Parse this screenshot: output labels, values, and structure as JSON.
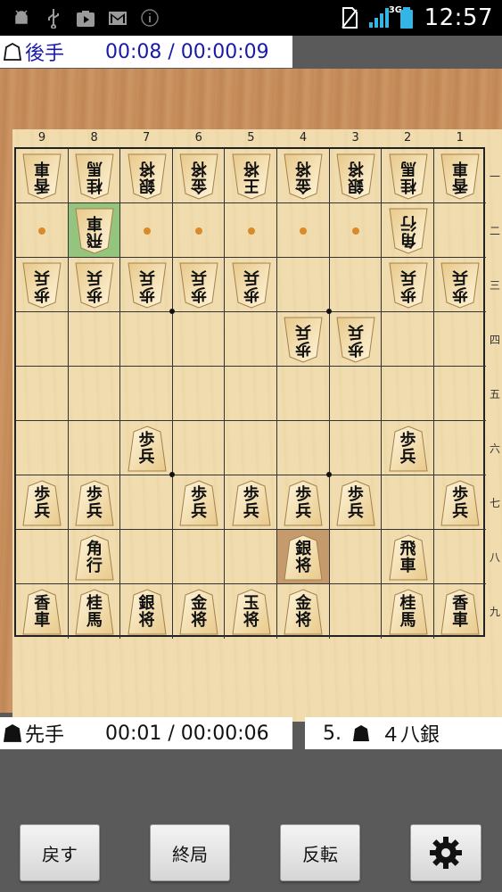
{
  "status_bar": {
    "time": "12:57",
    "network": "3G",
    "left_icons": [
      "android-debug-icon",
      "usb-icon",
      "play-store-icon",
      "gmail-icon",
      "info-icon"
    ],
    "right_icons": [
      "no-sim-icon",
      "signal-icon",
      "battery-icon"
    ]
  },
  "top_player": {
    "name": "後手",
    "time": "00:08 / 00:00:09"
  },
  "bottom_player": {
    "name": "先手",
    "time": "00:01 / 00:00:06"
  },
  "last_move": {
    "number": "5.",
    "text": "４八銀"
  },
  "board": {
    "file_labels": [
      "9",
      "8",
      "7",
      "6",
      "5",
      "4",
      "3",
      "2",
      "1"
    ],
    "rank_labels": [
      "一",
      "二",
      "三",
      "四",
      "五",
      "六",
      "七",
      "八",
      "九"
    ],
    "highlight_from": "8-2",
    "highlight_to": "4-8",
    "hint_cells": [
      "9-2",
      "7-2",
      "6-2",
      "5-2",
      "4-2",
      "3-2"
    ],
    "pieces": [
      {
        "file": 9,
        "rank": 1,
        "side": "gote",
        "label": "香車"
      },
      {
        "file": 8,
        "rank": 1,
        "side": "gote",
        "label": "桂馬"
      },
      {
        "file": 7,
        "rank": 1,
        "side": "gote",
        "label": "銀将"
      },
      {
        "file": 6,
        "rank": 1,
        "side": "gote",
        "label": "金将"
      },
      {
        "file": 5,
        "rank": 1,
        "side": "gote",
        "label": "王将"
      },
      {
        "file": 4,
        "rank": 1,
        "side": "gote",
        "label": "金将"
      },
      {
        "file": 3,
        "rank": 1,
        "side": "gote",
        "label": "銀将"
      },
      {
        "file": 2,
        "rank": 1,
        "side": "gote",
        "label": "桂馬"
      },
      {
        "file": 1,
        "rank": 1,
        "side": "gote",
        "label": "香車"
      },
      {
        "file": 8,
        "rank": 2,
        "side": "gote",
        "label": "飛車"
      },
      {
        "file": 2,
        "rank": 2,
        "side": "gote",
        "label": "角行"
      },
      {
        "file": 9,
        "rank": 3,
        "side": "gote",
        "label": "歩兵"
      },
      {
        "file": 8,
        "rank": 3,
        "side": "gote",
        "label": "歩兵"
      },
      {
        "file": 7,
        "rank": 3,
        "side": "gote",
        "label": "歩兵"
      },
      {
        "file": 6,
        "rank": 3,
        "side": "gote",
        "label": "歩兵"
      },
      {
        "file": 5,
        "rank": 3,
        "side": "gote",
        "label": "歩兵"
      },
      {
        "file": 2,
        "rank": 3,
        "side": "gote",
        "label": "歩兵"
      },
      {
        "file": 1,
        "rank": 3,
        "side": "gote",
        "label": "歩兵"
      },
      {
        "file": 4,
        "rank": 4,
        "side": "gote",
        "label": "歩兵"
      },
      {
        "file": 3,
        "rank": 4,
        "side": "gote",
        "label": "歩兵"
      },
      {
        "file": 7,
        "rank": 6,
        "side": "sente",
        "label": "歩兵"
      },
      {
        "file": 2,
        "rank": 6,
        "side": "sente",
        "label": "歩兵"
      },
      {
        "file": 9,
        "rank": 7,
        "side": "sente",
        "label": "歩兵"
      },
      {
        "file": 8,
        "rank": 7,
        "side": "sente",
        "label": "歩兵"
      },
      {
        "file": 6,
        "rank": 7,
        "side": "sente",
        "label": "歩兵"
      },
      {
        "file": 5,
        "rank": 7,
        "side": "sente",
        "label": "歩兵"
      },
      {
        "file": 4,
        "rank": 7,
        "side": "sente",
        "label": "歩兵"
      },
      {
        "file": 3,
        "rank": 7,
        "side": "sente",
        "label": "歩兵"
      },
      {
        "file": 1,
        "rank": 7,
        "side": "sente",
        "label": "歩兵"
      },
      {
        "file": 8,
        "rank": 8,
        "side": "sente",
        "label": "角行"
      },
      {
        "file": 4,
        "rank": 8,
        "side": "sente",
        "label": "銀将"
      },
      {
        "file": 2,
        "rank": 8,
        "side": "sente",
        "label": "飛車"
      },
      {
        "file": 9,
        "rank": 9,
        "side": "sente",
        "label": "香車"
      },
      {
        "file": 8,
        "rank": 9,
        "side": "sente",
        "label": "桂馬"
      },
      {
        "file": 7,
        "rank": 9,
        "side": "sente",
        "label": "銀将"
      },
      {
        "file": 6,
        "rank": 9,
        "side": "sente",
        "label": "金将"
      },
      {
        "file": 5,
        "rank": 9,
        "side": "sente",
        "label": "玉将"
      },
      {
        "file": 4,
        "rank": 9,
        "side": "sente",
        "label": "金将"
      },
      {
        "file": 2,
        "rank": 9,
        "side": "sente",
        "label": "桂馬"
      },
      {
        "file": 1,
        "rank": 9,
        "side": "sente",
        "label": "香車"
      }
    ]
  },
  "buttons": {
    "undo": "戻す",
    "end_game": "終局",
    "flip": "反転",
    "settings_icon": "gear-icon"
  },
  "colors": {
    "board": "#f0dcae",
    "highlight_from": "#94c47e",
    "highlight_to": "#c59a6c",
    "hint_dot": "#d98a2a",
    "top_player_text": "#1a1aa8"
  }
}
